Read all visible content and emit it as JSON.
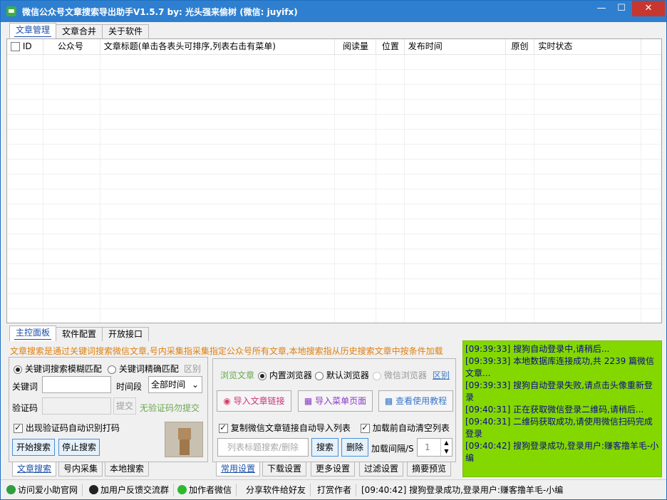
{
  "window": {
    "title": "微信公众号文章搜索导出助手V1.5.7    by: 光头强来偷树   (微信: juyifx)"
  },
  "top_tabs": [
    "文章管理",
    "文章合并",
    "关于软件"
  ],
  "table": {
    "columns": [
      "ID",
      "公众号",
      "文章标题(单击各表头可排序,列表右击有菜单)",
      "阅读量",
      "位置",
      "发布时间",
      "原创",
      "实时状态"
    ],
    "rows": []
  },
  "bottom_tabs": [
    "主控面板",
    "软件配置",
    "开放接口"
  ],
  "notice": "文章搜索是通过关键词搜索微信文章,号内采集指采集指定公众号所有文章,本地搜索指从历史搜索文章中按条件加载",
  "search_panel": {
    "radio_fuzzy": "关键词搜索模糊匹配",
    "radio_exact": "关键词精确匹配",
    "distinguish": "区别",
    "keyword_label": "关键词",
    "keyword_value": "",
    "period_label": "时间段",
    "period_value": "全部时间",
    "captcha_label": "验证码",
    "captcha_value": "",
    "submit": "提交",
    "no_captcha": "无验证码勿提交",
    "auto_captcha": "出现验证码自动识别打码",
    "start": "开始搜索",
    "stop": "停止搜索",
    "tabs": [
      "文章搜索",
      "号内采集",
      "本地搜索"
    ]
  },
  "settings_panel": {
    "browse_label": "浏览文章",
    "browser_builtin": "内置浏览器",
    "browser_default": "默认浏览器",
    "browser_wechat": "微信浏览器",
    "distinguish": "区别",
    "import_link": "导入文章链接",
    "import_menu": "导入菜单页面",
    "tutorial": "查看使用教程",
    "copy_auto_import": "复制微信文章链接自动导入列表",
    "clear_before_load": "加载前自动清空列表",
    "title_search_placeholder": "列表标题搜索/删除",
    "search": "搜索",
    "delete": "删除",
    "interval_label": "加载间隔/S",
    "interval_value": "1",
    "tabs": [
      "常用设置",
      "下载设置",
      "更多设置",
      "过滤设置",
      "摘要预览"
    ]
  },
  "log": [
    "[09:39:33] 搜狗自动登录中,请稍后...",
    "[09:39:33] 本地数据库连接成功,共 2239 篇微信文章...",
    "[09:39:33] 搜狗自动登录失败,请点击头像重新登录",
    "[09:40:31] 正在获取微信登录二维码,请稍后...",
    "[09:40:31] 二维码获取成功,请使用微信扫码完成登录",
    "[09:40:42] 搜狗登录成功,登录用户:赚客撸羊毛-小编"
  ],
  "status_bar": {
    "visit_site": "访问爱小助官网",
    "join_group": "加用户反馈交流群",
    "add_wechat": "加作者微信",
    "share": "分享软件给好友",
    "tip": "打赏作者",
    "message": "[09:40:42] 搜狗登录成功,登录用户:赚客撸羊毛-小编"
  },
  "colors": {
    "title_bar": "#2e7fd0",
    "close": "#c7372f",
    "log_bg": "#84d800",
    "notice": "#e07f0e"
  }
}
